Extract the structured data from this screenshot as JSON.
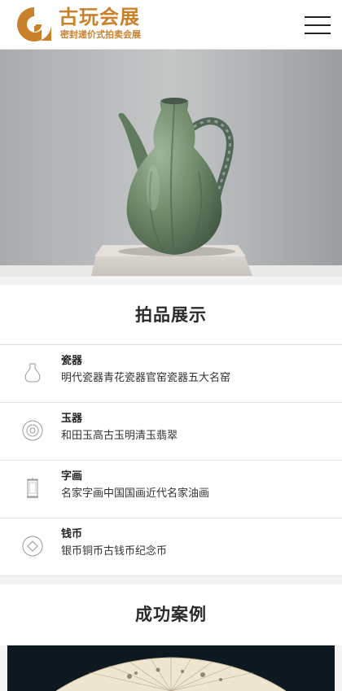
{
  "header": {
    "logo_title": "古玩会展",
    "logo_subtitle": "密封递价式拍卖会展",
    "menu_icon": "hamburger-menu-icon"
  },
  "hero": {
    "image_subject": "celadon-gourd-ewer"
  },
  "auction_section": {
    "title": "拍品展示",
    "categories": [
      {
        "name": "瓷器",
        "desc": "明代瓷器青花瓷器官窑瓷器五大名窑",
        "icon": "vase-icon"
      },
      {
        "name": "玉器",
        "desc": "和田玉高古玉明清玉翡翠",
        "icon": "jade-disc-icon"
      },
      {
        "name": "字画",
        "desc": "名家字画中国国画近代名家油画",
        "icon": "scroll-icon"
      },
      {
        "name": "钱币",
        "desc": "银币铜币古钱币纪念币",
        "icon": "coin-icon"
      }
    ]
  },
  "cases_section": {
    "title": "成功案例"
  },
  "colors": {
    "brand": "#c9822b",
    "text": "#333333",
    "case_bg": "#0d1820"
  }
}
